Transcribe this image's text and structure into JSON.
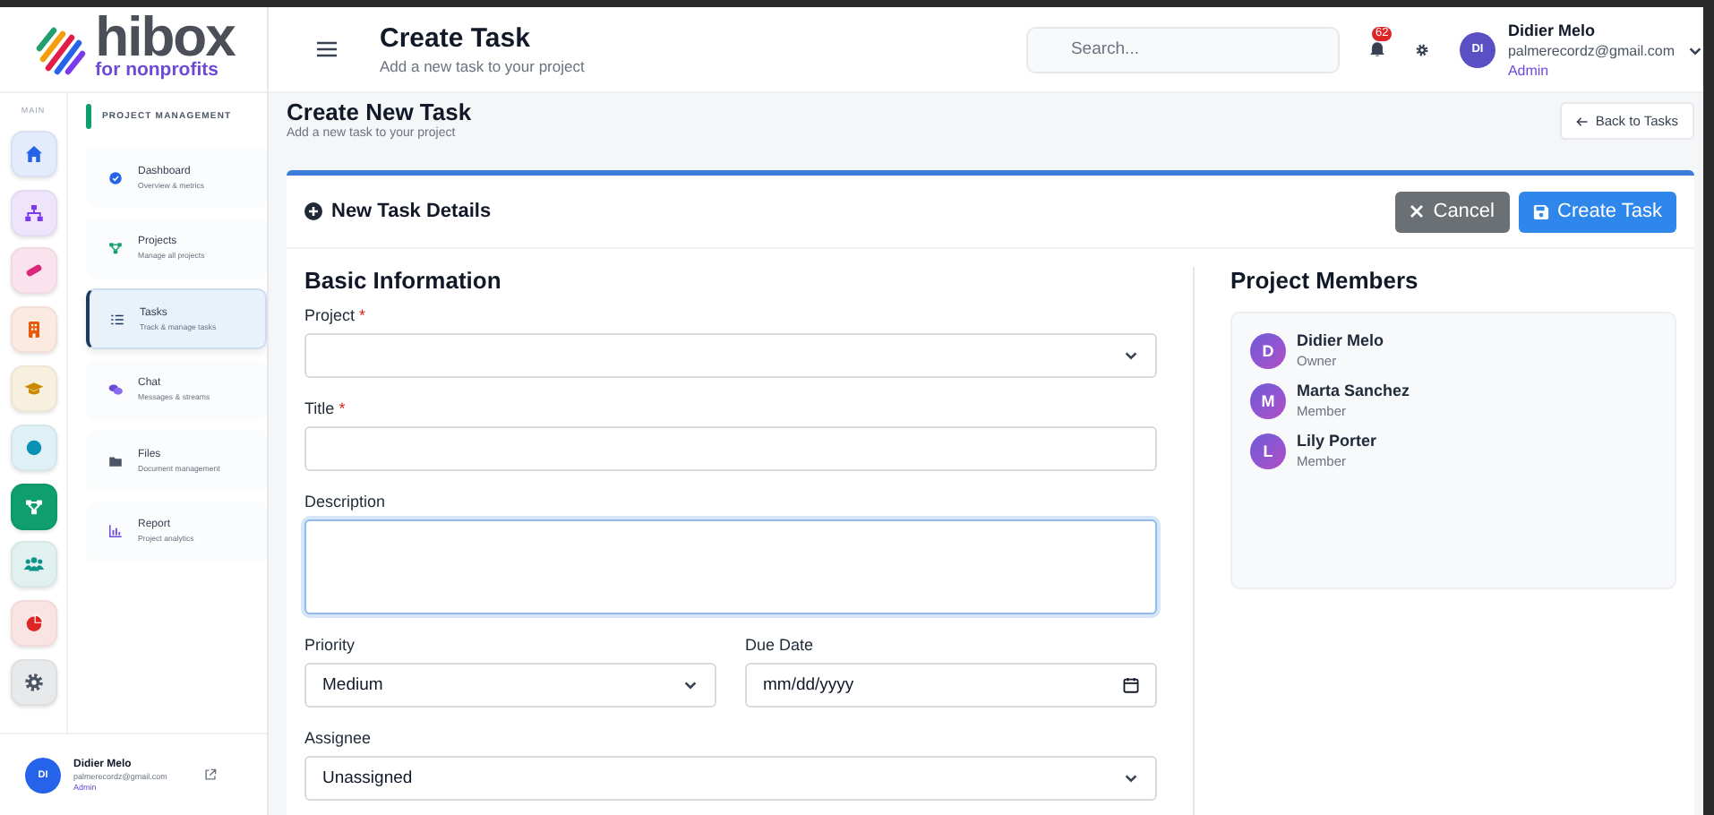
{
  "brand": {
    "name": "hibox",
    "tagline": "for nonprofits"
  },
  "header": {
    "title": "Create Task",
    "subtitle": "Add a new task to your project",
    "search": {
      "placeholder": "Search..."
    },
    "notifications": {
      "count": "62"
    },
    "user": {
      "initials": "DI",
      "name": "Didier Melo",
      "email": "palmerecordz@gmail.com",
      "role": "Admin"
    }
  },
  "rail": {
    "label": "MAIN",
    "items": [
      {
        "selected": false,
        "color": "#2563eb"
      },
      {
        "selected": false,
        "color": "#7c3aed"
      },
      {
        "selected": false,
        "color": "#db2777"
      },
      {
        "selected": false,
        "color": "#ea580c"
      },
      {
        "selected": false,
        "color": "#ca8a04"
      },
      {
        "selected": false,
        "color": "#0891b2"
      },
      {
        "selected": true,
        "color": "#0f9f6e"
      },
      {
        "selected": false,
        "color": "#0d9488"
      },
      {
        "selected": false,
        "color": "#dc2626"
      },
      {
        "selected": false,
        "color": "#4b5563"
      }
    ]
  },
  "nav": {
    "section": "PROJECT MANAGEMENT",
    "items": [
      {
        "title": "Dashboard",
        "subtitle": "Overview & metrics",
        "selected": false
      },
      {
        "title": "Projects",
        "subtitle": "Manage all projects",
        "selected": false
      },
      {
        "title": "Tasks",
        "subtitle": "Track & manage tasks",
        "selected": true
      },
      {
        "title": "Chat",
        "subtitle": "Messages & streams",
        "selected": false
      },
      {
        "title": "Files",
        "subtitle": "Document management",
        "selected": false
      },
      {
        "title": "Report",
        "subtitle": "Project analytics",
        "selected": false
      }
    ]
  },
  "sidebar_user": {
    "initials": "DI",
    "name": "Didier Melo",
    "email": "palmerecordz@gmail.com",
    "role": "Admin"
  },
  "page": {
    "title": "Create New Task",
    "subtitle": "Add a new task to your project",
    "back_button": "Back to Tasks"
  },
  "card": {
    "title": "New Task Details",
    "actions": [
      {
        "kind": "secondary",
        "label": "Cancel"
      },
      {
        "kind": "primary",
        "label": "Create Task"
      }
    ],
    "section": "Basic Information",
    "rows": [
      [
        {
          "label": "Project",
          "required_mark": "*",
          "kind": "select",
          "focused": false
        }
      ],
      [
        {
          "label": "Title",
          "required_mark": "*",
          "kind": "text",
          "focused": false
        }
      ],
      [
        {
          "label": "Description",
          "kind": "textarea",
          "focused": true
        }
      ],
      [
        {
          "label": "Priority",
          "kind": "select",
          "value": "Medium",
          "focused": false
        },
        {
          "label": "Due Date",
          "kind": "date",
          "placeholder": "mm/dd/yyyy",
          "focused": false
        }
      ],
      [
        {
          "label": "Assignee",
          "kind": "select",
          "value": "Unassigned",
          "focused": false
        }
      ]
    ],
    "members": {
      "title": "Project Members",
      "items": [
        {
          "initial": "D",
          "name": "Didier Melo",
          "role": "Owner"
        },
        {
          "initial": "M",
          "name": "Marta Sanchez",
          "role": "Member"
        },
        {
          "initial": "L",
          "name": "Lily Porter",
          "role": "Member"
        }
      ]
    }
  }
}
